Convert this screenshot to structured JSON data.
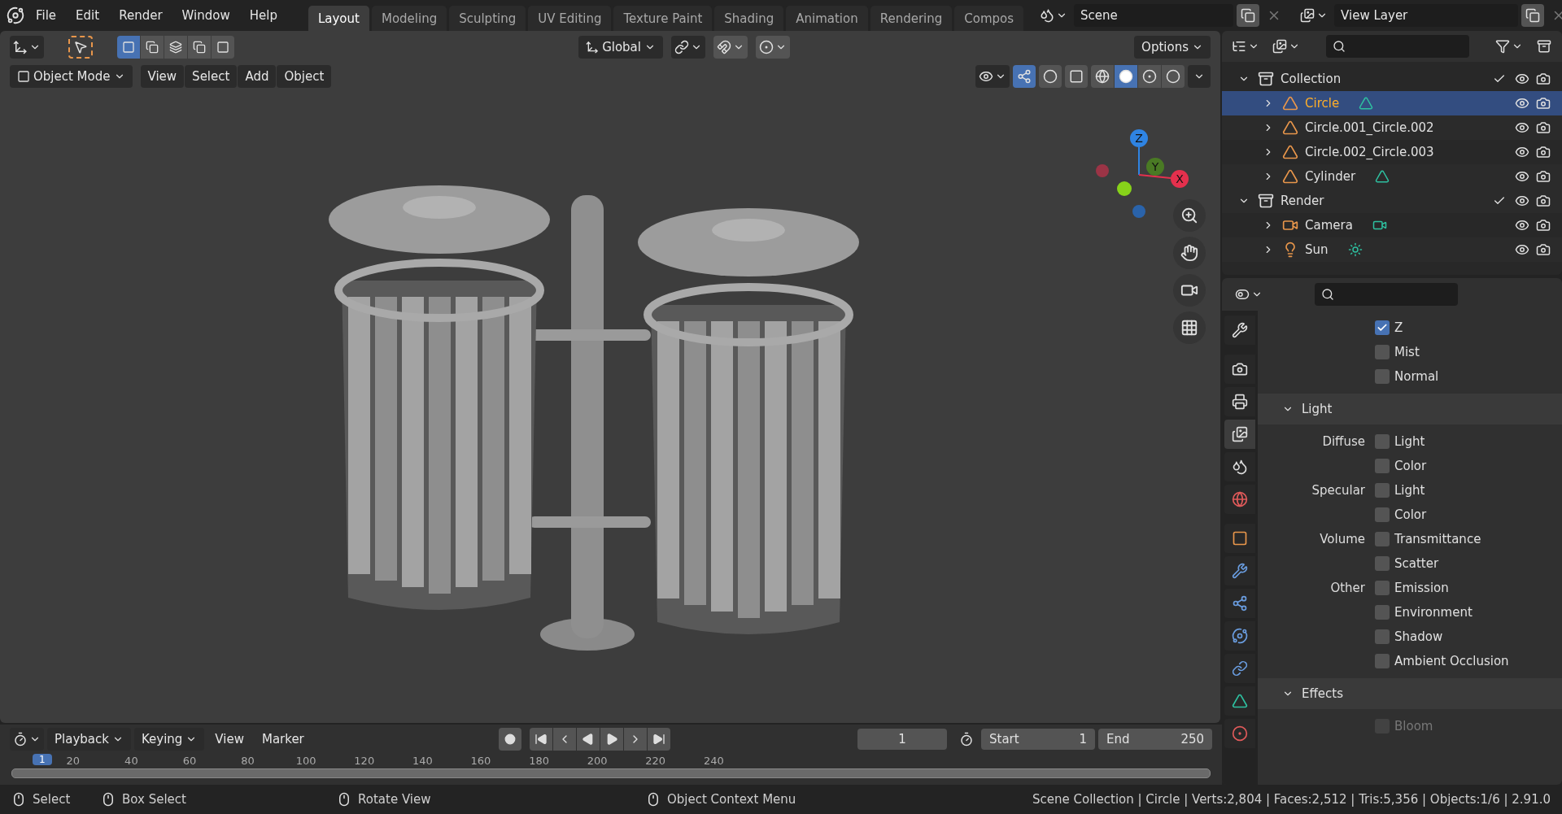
{
  "menu": [
    "File",
    "Edit",
    "Render",
    "Window",
    "Help"
  ],
  "workspaces": [
    {
      "label": "Layout",
      "selected": true
    },
    {
      "label": "Modeling",
      "selected": false
    },
    {
      "label": "Sculpting",
      "selected": false
    },
    {
      "label": "UV Editing",
      "selected": false
    },
    {
      "label": "Texture Paint",
      "selected": false
    },
    {
      "label": "Shading",
      "selected": false
    },
    {
      "label": "Animation",
      "selected": false
    },
    {
      "label": "Rendering",
      "selected": false
    },
    {
      "label": "Compos",
      "selected": false
    }
  ],
  "scene": {
    "value": "Scene"
  },
  "view_layer": {
    "value": "View Layer"
  },
  "tool_header": {
    "select_modes": [
      {
        "selected": true
      },
      {
        "selected": false
      },
      {
        "selected": false
      },
      {
        "selected": false
      },
      {
        "selected": false
      }
    ],
    "orientation": "Global",
    "options": "Options"
  },
  "viewport_header": {
    "mode": "Object Mode",
    "menus": [
      "View",
      "Select",
      "Add",
      "Object"
    ],
    "shading": [
      {
        "selected": false
      },
      {
        "selected": true
      },
      {
        "selected": false
      },
      {
        "selected": false
      }
    ]
  },
  "gizmo": {
    "axes": [
      "Z",
      "Y",
      "X"
    ]
  },
  "outliner": {
    "items": [
      {
        "label": "Collection",
        "kind": "collection",
        "checked": true,
        "expanded": true,
        "selected": false,
        "children": [
          {
            "label": "Circle",
            "kind": "mesh",
            "data_icon": true,
            "selected": true
          },
          {
            "label": "Circle.001_Circle.002",
            "kind": "mesh",
            "selected": false
          },
          {
            "label": "Circle.002_Circle.003",
            "kind": "mesh",
            "selected": false
          },
          {
            "label": "Cylinder",
            "kind": "mesh",
            "data_icon": true,
            "selected": false
          }
        ]
      },
      {
        "label": "Render",
        "kind": "collection",
        "checked": true,
        "expanded": true,
        "selected": false,
        "children": [
          {
            "label": "Camera",
            "kind": "camera",
            "data_icon": true,
            "selected": false
          },
          {
            "label": "Sun",
            "kind": "light",
            "data_icon": true,
            "selected": false
          }
        ]
      }
    ]
  },
  "properties": {
    "tabs": [
      {
        "kind": "tool",
        "selected": false
      },
      {
        "kind": "render",
        "selected": false
      },
      {
        "kind": "output",
        "selected": false
      },
      {
        "kind": "view_layer",
        "selected": true
      },
      {
        "kind": "scene",
        "selected": false
      },
      {
        "kind": "world",
        "selected": false
      },
      {
        "kind": "object",
        "selected": false
      },
      {
        "kind": "modifiers",
        "selected": false
      },
      {
        "kind": "particles",
        "selected": false
      },
      {
        "kind": "physics",
        "selected": false
      },
      {
        "kind": "constraints",
        "selected": false
      },
      {
        "kind": "data",
        "selected": false
      },
      {
        "kind": "material",
        "selected": false
      }
    ],
    "passes": [
      {
        "label": "Z",
        "checked": true
      },
      {
        "label": "Mist",
        "checked": false
      },
      {
        "label": "Normal",
        "checked": false
      }
    ],
    "panels": [
      {
        "title": "Light",
        "expanded": true,
        "groups": [
          {
            "label": "Diffuse",
            "options": [
              {
                "label": "Light",
                "checked": false,
                "disabled": false
              },
              {
                "label": "Color",
                "checked": false,
                "disabled": false
              }
            ]
          },
          {
            "label": "Specular",
            "options": [
              {
                "label": "Light",
                "checked": false,
                "disabled": false
              },
              {
                "label": "Color",
                "checked": false,
                "disabled": false
              }
            ]
          },
          {
            "label": "Volume",
            "options": [
              {
                "label": "Transmittance",
                "checked": false,
                "disabled": false
              },
              {
                "label": "Scatter",
                "checked": false,
                "disabled": false
              }
            ]
          },
          {
            "label": "Other",
            "options": [
              {
                "label": "Emission",
                "checked": false,
                "disabled": false
              },
              {
                "label": "Environment",
                "checked": false,
                "disabled": false
              },
              {
                "label": "Shadow",
                "checked": false,
                "disabled": false
              },
              {
                "label": "Ambient Occlusion",
                "checked": false,
                "disabled": false
              }
            ]
          }
        ]
      },
      {
        "title": "Effects",
        "expanded": true,
        "groups": [
          {
            "options": [
              {
                "label": "Bloom",
                "checked": false,
                "disabled": true
              }
            ]
          }
        ]
      }
    ]
  },
  "timeline": {
    "menus": [
      "Playback",
      "Keying",
      "View",
      "Marker"
    ],
    "current_frame": "1",
    "start": {
      "label": "Start",
      "value": "1"
    },
    "end": {
      "label": "End",
      "value": "250"
    },
    "marker": "1",
    "ruler": [
      "20",
      "40",
      "60",
      "80",
      "100",
      "120",
      "140",
      "160",
      "180",
      "200",
      "220",
      "240"
    ]
  },
  "status_bar": {
    "hints": [
      "Select",
      "Box Select",
      "Rotate View",
      "Object Context Menu"
    ],
    "stats": "Scene Collection | Circle | Verts:2,804 | Faces:2,512 | Tris:5,356 | Objects:1/6 | 2.91.0"
  }
}
